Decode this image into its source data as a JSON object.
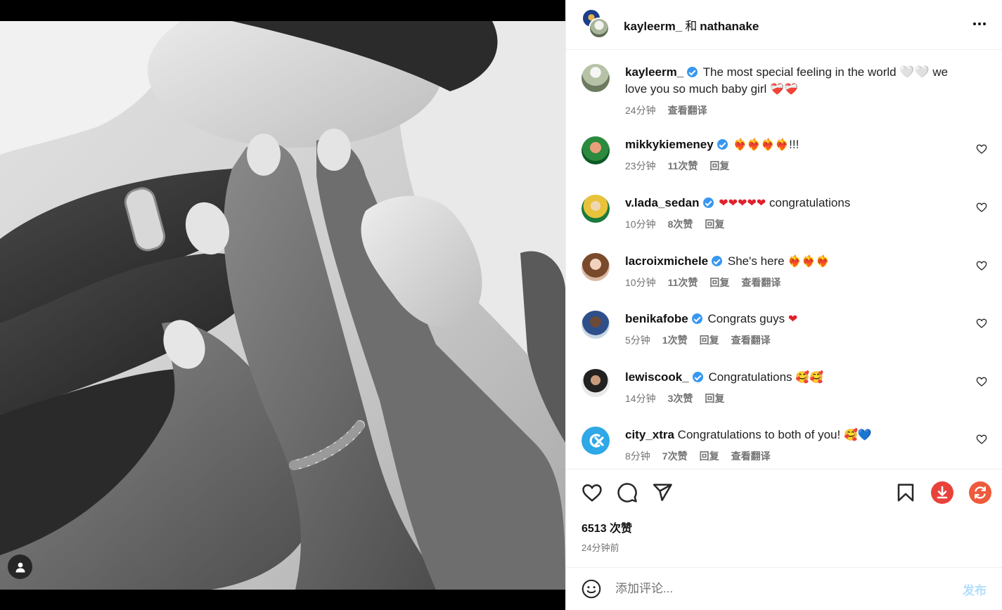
{
  "post": {
    "authors": {
      "primary": "kayleerm_",
      "connector": "和",
      "secondary": "nathanake"
    },
    "caption": {
      "username": "kayleerm_",
      "text": "The most special feeling in the world 🤍🤍 we love you so much baby girl",
      "emoji_tail": "❤‍🩹❤‍🩹",
      "time": "24分钟",
      "translate": "查看翻译"
    },
    "comments": [
      {
        "username": "mikkykiemeney",
        "verified": true,
        "text": "",
        "emoji": "❤‍🔥❤‍🔥❤‍🔥❤‍🔥",
        "suffix": "!!!",
        "time": "23分钟",
        "likes": "11次赞",
        "reply": "回复",
        "translate": ""
      },
      {
        "username": "v.lada_sedan",
        "verified": true,
        "text": "",
        "emoji": "❤❤❤❤❤",
        "suffix": " congratulations",
        "time": "10分钟",
        "likes": "8次赞",
        "reply": "回复",
        "translate": ""
      },
      {
        "username": "lacroixmichele",
        "verified": true,
        "text": "She's here ",
        "emoji": "❤‍🔥❤‍🔥❤‍🔥",
        "suffix": "",
        "time": "10分钟",
        "likes": "11次赞",
        "reply": "回复",
        "translate": "查看翻译"
      },
      {
        "username": "benikafobe",
        "verified": true,
        "text": "Congrats guys ",
        "emoji": "❤",
        "suffix": "",
        "time": "5分钟",
        "likes": "1次赞",
        "reply": "回复",
        "translate": "查看翻译"
      },
      {
        "username": "lewiscook_",
        "verified": true,
        "text": "Congratulations ",
        "emoji": "🥰🥰",
        "suffix": "",
        "time": "14分钟",
        "likes": "3次赞",
        "reply": "回复",
        "translate": ""
      },
      {
        "username": "city_xtra",
        "verified": false,
        "text": "Congratulations to both of you! ",
        "emoji": "🥰💙",
        "suffix": "",
        "time": "8分钟",
        "likes": "7次赞",
        "reply": "回复",
        "translate": "查看翻译"
      }
    ],
    "like_count": "6513 次赞",
    "posted_ago": "24分钟前",
    "composer": {
      "placeholder": "添加评论...",
      "post_label": "发布"
    }
  },
  "icons": {
    "like": "heart-icon",
    "comment": "comment-icon",
    "share": "send-icon",
    "save": "bookmark-icon",
    "download": "download-icon",
    "refresh": "refresh-icon",
    "more": "more-icon",
    "emoji": "emoji-icon",
    "tag_user": "user-icon"
  },
  "colors": {
    "accent": "#0095f6",
    "verified": "#3897f0",
    "download": "#e8423b",
    "refresh": "#ef5a3c",
    "post_disabled": "#b2dffc"
  }
}
